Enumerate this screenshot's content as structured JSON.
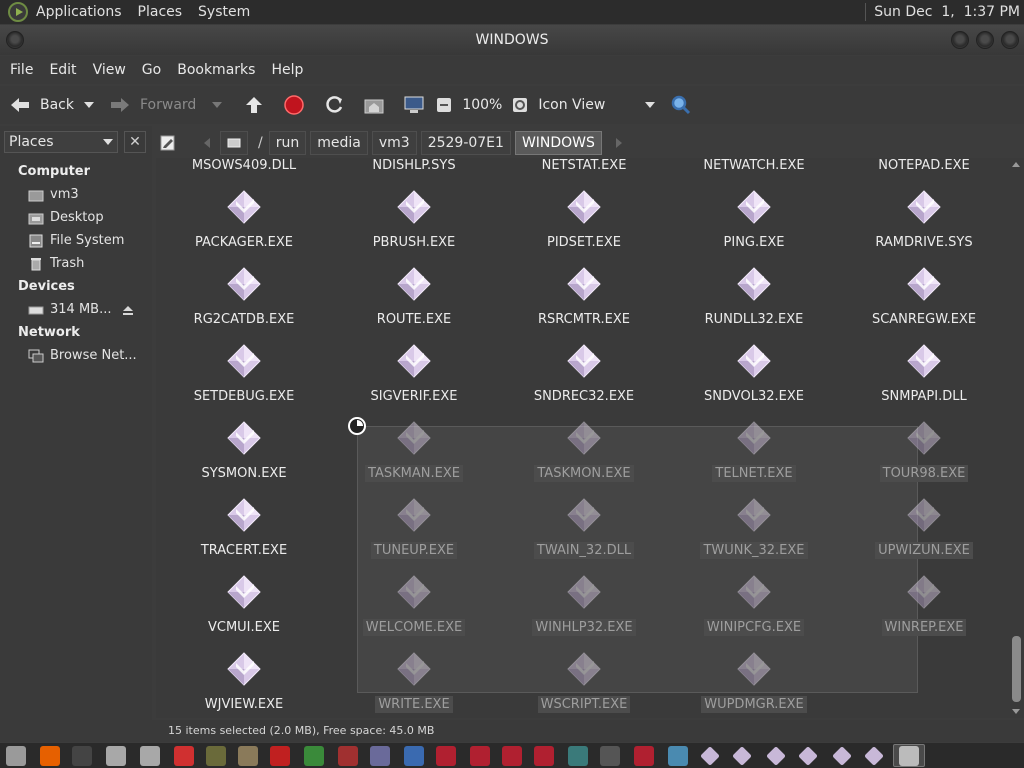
{
  "top_panel": {
    "menus": [
      "Applications",
      "Places",
      "System"
    ],
    "clock": "Sun Dec  1,  1:37 PM"
  },
  "window": {
    "title": "WINDOWS"
  },
  "menubar": [
    "File",
    "Edit",
    "View",
    "Go",
    "Bookmarks",
    "Help"
  ],
  "toolbar": {
    "back": "Back",
    "forward": "Forward",
    "zoom": "100%",
    "view_mode": "Icon View"
  },
  "sidebar": {
    "selector": "Places",
    "close": "✕",
    "sections": [
      {
        "heading": "Computer",
        "items": [
          {
            "label": "vm3",
            "icon": "home-folder-icon"
          },
          {
            "label": "Desktop",
            "icon": "desktop-folder-icon"
          },
          {
            "label": "File System",
            "icon": "filesystem-icon"
          },
          {
            "label": "Trash",
            "icon": "trash-icon"
          }
        ]
      },
      {
        "heading": "Devices",
        "items": [
          {
            "label": "314 MB...",
            "icon": "drive-icon"
          }
        ]
      },
      {
        "heading": "Network",
        "items": [
          {
            "label": "Browse Net...",
            "icon": "network-icon"
          }
        ]
      }
    ]
  },
  "pathbar": {
    "sep": "/",
    "crumbs": [
      "run",
      "media",
      "vm3",
      "2529-07E1",
      "WINDOWS"
    ]
  },
  "files": {
    "partial_row": [
      "MSOWS409.DLL",
      "NDISHLP.SYS",
      "NETSTAT.EXE",
      "NETWATCH.EXE",
      "NOTEPAD.EXE"
    ],
    "rows": [
      [
        "PACKAGER.EXE",
        "PBRUSH.EXE",
        "PIDSET.EXE",
        "PING.EXE",
        "RAMDRIVE.SYS"
      ],
      [
        "RG2CATDB.EXE",
        "ROUTE.EXE",
        "RSRCMTR.EXE",
        "RUNDLL32.EXE",
        "SCANREGW.EXE"
      ],
      [
        "SETDEBUG.EXE",
        "SIGVERIF.EXE",
        "SNDREC32.EXE",
        "SNDVOL32.EXE",
        "SNMPAPI.DLL"
      ],
      [
        "SYSMON.EXE",
        "TASKMAN.EXE",
        "TASKMON.EXE",
        "TELNET.EXE",
        "TOUR98.EXE"
      ],
      [
        "TRACERT.EXE",
        "TUNEUP.EXE",
        "TWAIN_32.DLL",
        "TWUNK_32.EXE",
        "UPWIZUN.EXE"
      ],
      [
        "VCMUI.EXE",
        "WELCOME.EXE",
        "WINHLP32.EXE",
        "WINIPCFG.EXE",
        "WINREP.EXE"
      ],
      [
        "WJVIEW.EXE",
        "WRITE.EXE",
        "WSCRIPT.EXE",
        "WUPDMGR.EXE"
      ]
    ],
    "selected": [
      "TASKMAN.EXE",
      "TASKMON.EXE",
      "TELNET.EXE",
      "TOUR98.EXE",
      "TUNEUP.EXE",
      "TWAIN_32.DLL",
      "TWUNK_32.EXE",
      "UPWIZUN.EXE",
      "WELCOME.EXE",
      "WINHLP32.EXE",
      "WINIPCFG.EXE",
      "WINREP.EXE",
      "WRITE.EXE",
      "WSCRIPT.EXE",
      "WUPDMGR.EXE"
    ]
  },
  "status": "15 items selected (2.0 MB), Free space: 45.0 MB",
  "colors": {
    "bg": "#3a3a3a",
    "panel": "#2c2c2c",
    "file_icon": "#d8c8e6",
    "stop": "#c0141e",
    "search": "#5a9ad8"
  }
}
